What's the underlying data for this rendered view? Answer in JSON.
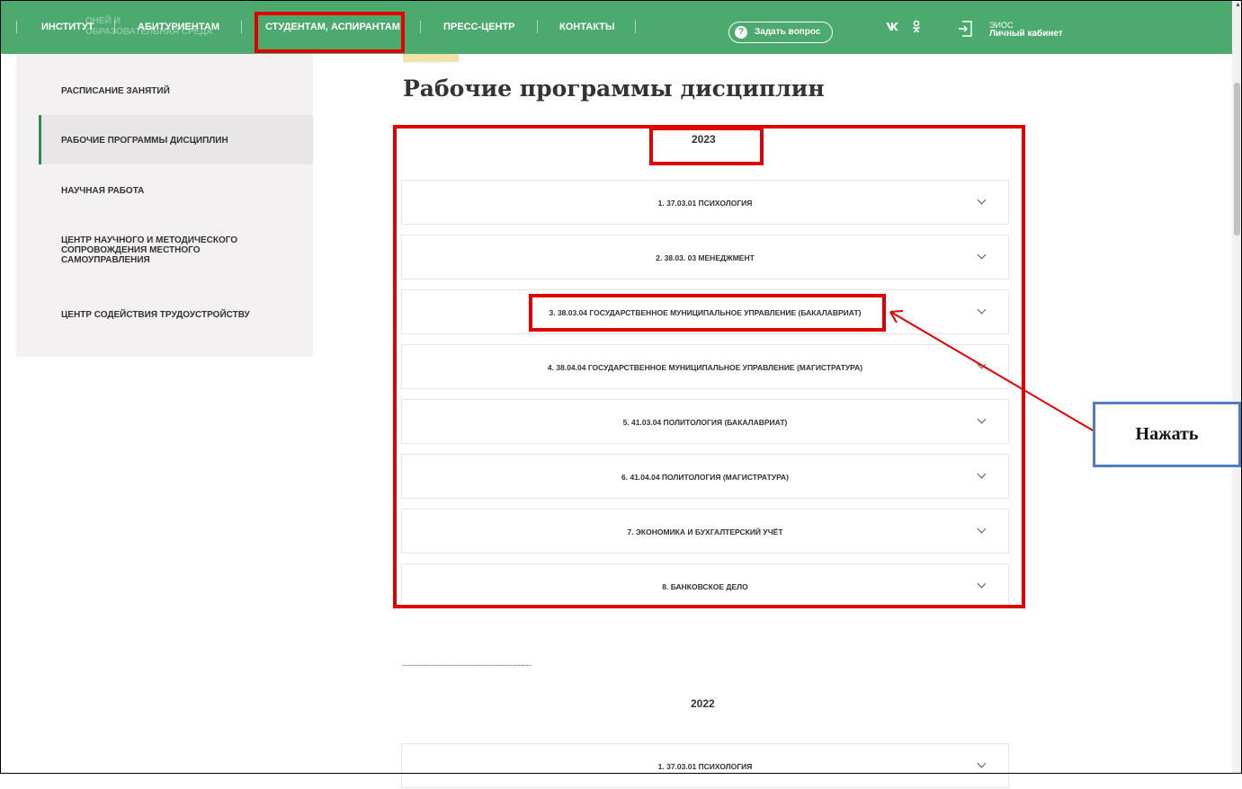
{
  "nav": {
    "items": [
      "ИНСТИТУТ",
      "АБИТУРИЕНТАМ",
      "СТУДЕНТАМ, АСПИРАНТАМ",
      "ПРЕСС-ЦЕНТР",
      "КОНТАКТЫ"
    ],
    "ghost_line1": "ОНЕЙ И",
    "ghost_line2": "ОБРАЗОВАТЕЛЬНАЯ СРЕДА",
    "ask_label": "Задать вопрос",
    "ask_icon": "?",
    "vk": "vk",
    "ok": "ok",
    "eios_top": "ЭИОС",
    "eios_bottom": "Личный кабинет",
    "color": "#4caa6e"
  },
  "sidebar": {
    "items": [
      "РАСПИСАНИЕ ЗАНЯТИЙ",
      "РАБОЧИЕ ПРОГРАММЫ ДИСЦИПЛИН",
      "НАУЧНАЯ РАБОТА",
      "ЦЕНТР НАУЧНОГО И МЕТОДИЧЕСКОГО СОПРОВОЖДЕНИЯ МЕСТНОГО САМОУПРАВЛЕНИЯ",
      "ЦЕНТР СОДЕЙСТВИЯ ТРУДОУСТРОЙСТВУ"
    ],
    "active_index": 1
  },
  "main": {
    "title": "Рабочие программы дисциплин",
    "year_2023": "2023",
    "programs_2023": [
      "1. 37.03.01 ПСИХОЛОГИЯ",
      "2. 38.03. 03 МЕНЕДЖМЕНТ",
      "3. 38.03.04 ГОСУДАРСТВЕННОЕ МУНИЦИПАЛЬНОЕ УПРАВЛЕНИЕ (БАКАЛАВРИАТ)",
      "4. 38.04.04 ГОСУДАРСТВЕННОЕ МУНИЦИПАЛЬНОЕ УПРАВЛЕНИЕ (МАГИСТРАТУРА)",
      "5. 41.03.04 ПОЛИТОЛОГИЯ (БАКАЛАВРИАТ)",
      "6. 41.04.04 ПОЛИТОЛОГИЯ (МАГИСТРАТУРА)",
      "7. ЭКОНОМИКА И БУХГАЛТЕРСКИЙ УЧЁТ",
      "8. БАНКОВСКОЕ ДЕЛО"
    ],
    "separator": "------------------------------------------------",
    "year_2022": "2022",
    "programs_2022": [
      "1. 37.03.01 ПСИХОЛОГИЯ"
    ]
  },
  "callout": {
    "text": "Нажать",
    "border_color": "#4f7fc0"
  },
  "annotation_color": "#e00000"
}
